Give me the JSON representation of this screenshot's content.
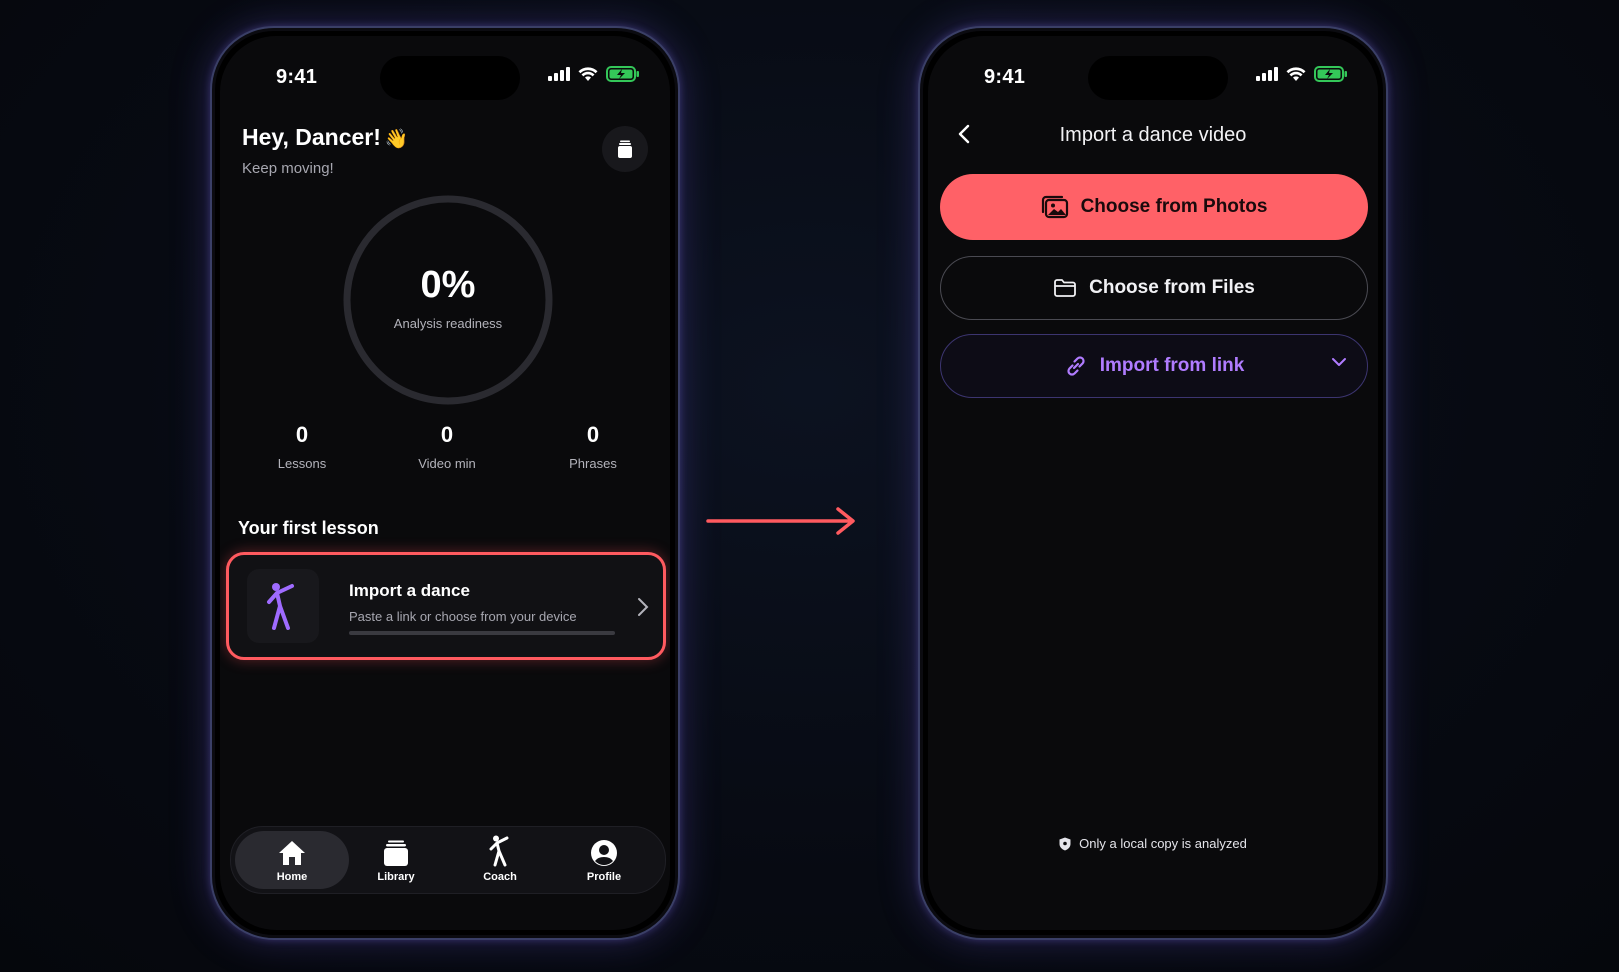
{
  "home": {
    "status": {
      "time": "9:41"
    },
    "greeting": "Hey, Dancer!",
    "wave_emoji": "👋",
    "subtitle": "Keep moving!",
    "readiness": {
      "value": "0%",
      "label": "Analysis readiness",
      "fraction": 0
    },
    "stats": [
      {
        "value": "0",
        "label": "Lessons"
      },
      {
        "value": "0",
        "label": "Video min"
      },
      {
        "value": "0",
        "label": "Phrases"
      }
    ],
    "section_title": "Your first lesson",
    "lesson": {
      "title": "Import a dance",
      "subtitle": "Paste a link or choose from your device",
      "progress": 0
    },
    "tabs": [
      {
        "label": "Home",
        "icon": "home-icon",
        "active": true
      },
      {
        "label": "Library",
        "icon": "library-icon",
        "active": false
      },
      {
        "label": "Coach",
        "icon": "dancer-icon",
        "active": false
      },
      {
        "label": "Profile",
        "icon": "profile-icon",
        "active": false
      }
    ]
  },
  "import": {
    "status": {
      "time": "9:41"
    },
    "title": "Import a dance video",
    "choose_photos": "Choose from Photos",
    "choose_files": "Choose from Files",
    "import_link": "Import from link",
    "footnote": "Only a local copy is analyzed"
  },
  "colors": {
    "accent_red": "#ff6167",
    "accent_purple": "#b07cff",
    "battery_green": "#34c759"
  }
}
